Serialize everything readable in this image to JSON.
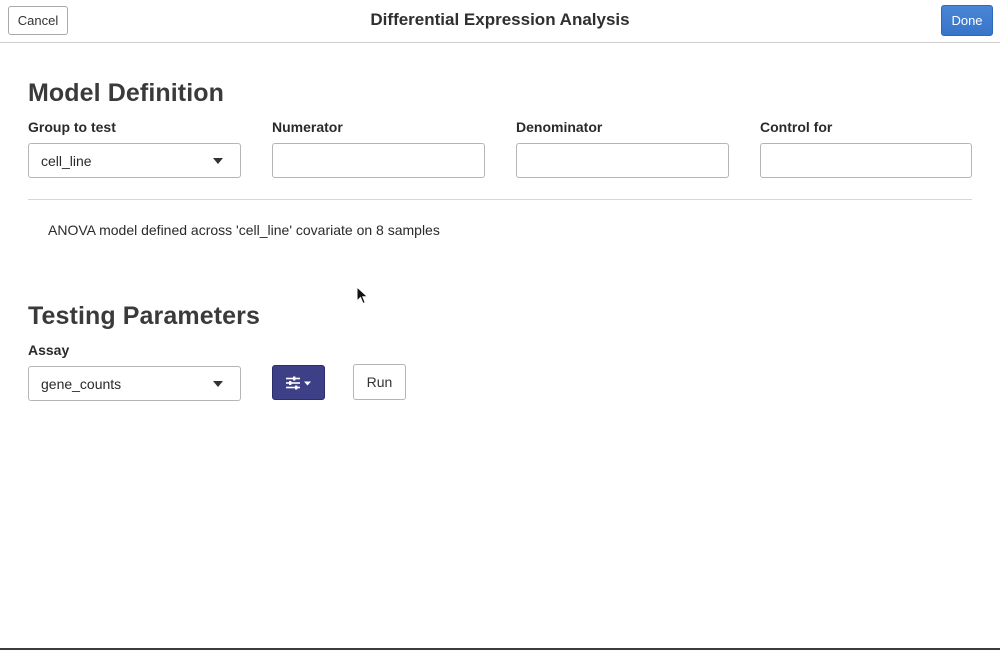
{
  "header": {
    "title": "Differential Expression Analysis",
    "cancel_label": "Cancel",
    "done_label": "Done"
  },
  "model_definition": {
    "title": "Model Definition",
    "fields": [
      {
        "label": "Group to test",
        "value": "cell_line",
        "type": "select"
      },
      {
        "label": "Numerator",
        "value": "",
        "type": "select"
      },
      {
        "label": "Denominator",
        "value": "",
        "type": "select"
      },
      {
        "label": "Control for",
        "value": "",
        "type": "select"
      }
    ],
    "description": "ANOVA model defined across 'cell_line' covariate on 8 samples"
  },
  "testing_parameters": {
    "title": "Testing Parameters",
    "assay_label": "Assay",
    "assay_value": "gene_counts",
    "settings_icon": "sliders-icon",
    "run_label": "Run"
  },
  "colors": {
    "done_button": "#3a7bd5",
    "settings_button": "#3d4087"
  }
}
